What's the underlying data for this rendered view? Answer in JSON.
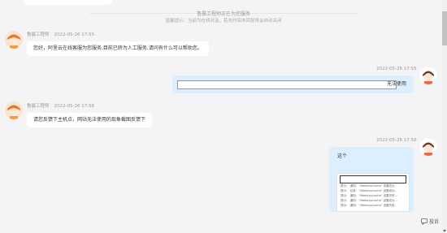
{
  "system": {
    "line1": "鲁晨工程师正在为您服务",
    "line2": "温馨提示：当前为在线对话，若长时间未回复将会自动关闭"
  },
  "messages": [
    {
      "side": "left",
      "name": "鲁晨工程师",
      "time": "2022-05-26 17:55",
      "text": "您好，阿里云在线客服为您服务,目前已转为人工服务,请问有什么可以帮助您。"
    },
    {
      "side": "right",
      "time": "2022-05-26 17:55",
      "text": "无法使用"
    },
    {
      "side": "left",
      "name": "鲁晨工程师",
      "time": "2022-05-26 17:56",
      "text": "请您反馈下主机点，网站无法使用的现象截图反馈下"
    },
    {
      "side": "right",
      "time": "2022-05-26 17:56",
      "text": "这个"
    }
  ],
  "screenshot_rows": [
    "提示：   通知：\"/Websys/cache\" 设置成为...",
    "提示：   目录：\"/Websys/cache\" 设置成功...",
    "提示：   通知：\"/Websys/cache\" 设置失败...",
    "提示：   通知：\"/Websys/cache\" 设置成为...",
    "提示：   通知：\"/Websys/cache\" 设置失败..."
  ],
  "feedback_label": "投诉",
  "colors": {
    "page_bg": "#f4f4f6",
    "user_bubble": "#ddeefe",
    "agent_bubble": "#ffffff"
  }
}
